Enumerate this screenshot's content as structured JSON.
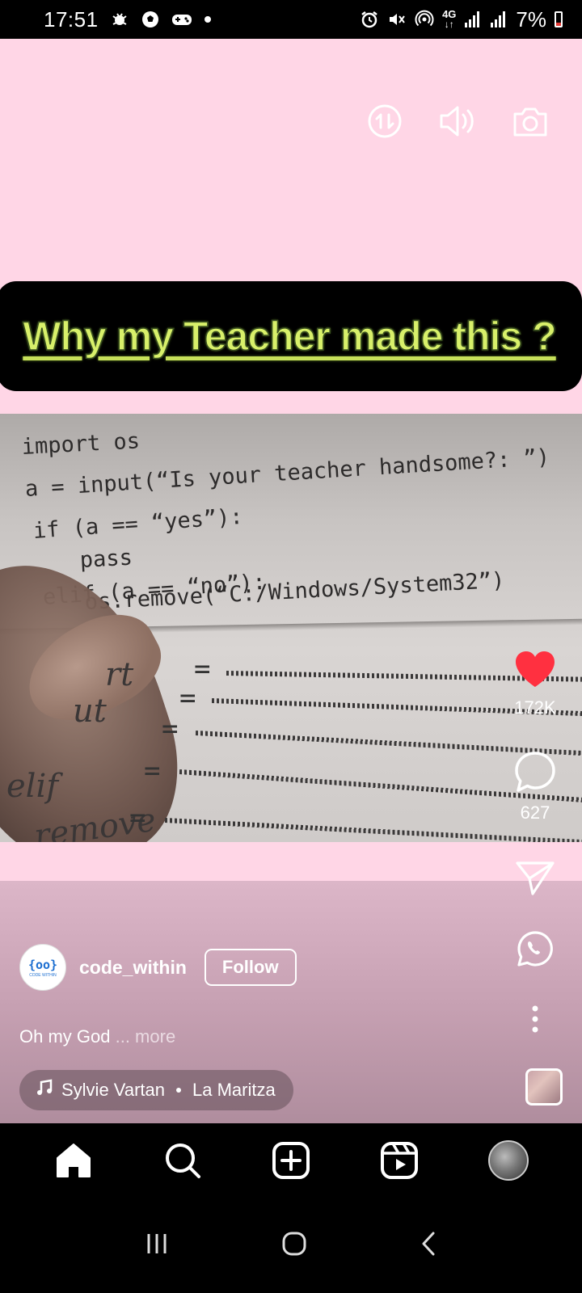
{
  "status_bar": {
    "time": "17:51",
    "left_icons": [
      "notification-bug-icon",
      "soccer-ball-icon",
      "gamepad-icon",
      "dot-icon"
    ],
    "right_icons": [
      "alarm-icon",
      "mute-icon",
      "hotspot-icon",
      "4g-icon",
      "signal-icon",
      "signal-icon"
    ],
    "network": "4G",
    "battery": "7%"
  },
  "top_actions": [
    "switch-icon",
    "volume-icon",
    "camera-icon"
  ],
  "reel": {
    "banner_text": "Why my Teacher made this  ?",
    "photo_code": {
      "line1": "import os",
      "line2": "a = input(“Is your teacher handsome?: ”)",
      "line3": "if (a == “yes”):",
      "line4": "pass",
      "line5": "elif (a == “no”):",
      "line6": "os.remove(“C:/Windows/System32”)",
      "handwritten": [
        "rt",
        "ut",
        "elif",
        "remove"
      ],
      "eq": "="
    }
  },
  "actions": {
    "likes": "172K",
    "comments": "627"
  },
  "author": {
    "avatar_logo": "{oo}",
    "avatar_sub": "CODE WITHIN",
    "username": "code_within",
    "follow_label": "Follow"
  },
  "caption": {
    "text": "Oh my God",
    "more": "... more"
  },
  "music": {
    "artist": "Sylvie Vartan",
    "title": "La Maritza"
  },
  "bottom_nav": [
    "home-icon",
    "search-icon",
    "create-icon",
    "reels-icon",
    "profile-avatar"
  ],
  "system_nav": [
    "recents-icon",
    "home-circle-icon",
    "back-icon"
  ],
  "colors": {
    "background_pink": "#ffd6e6",
    "banner_text": "#d8f06a",
    "like_red": "#ff3040"
  }
}
